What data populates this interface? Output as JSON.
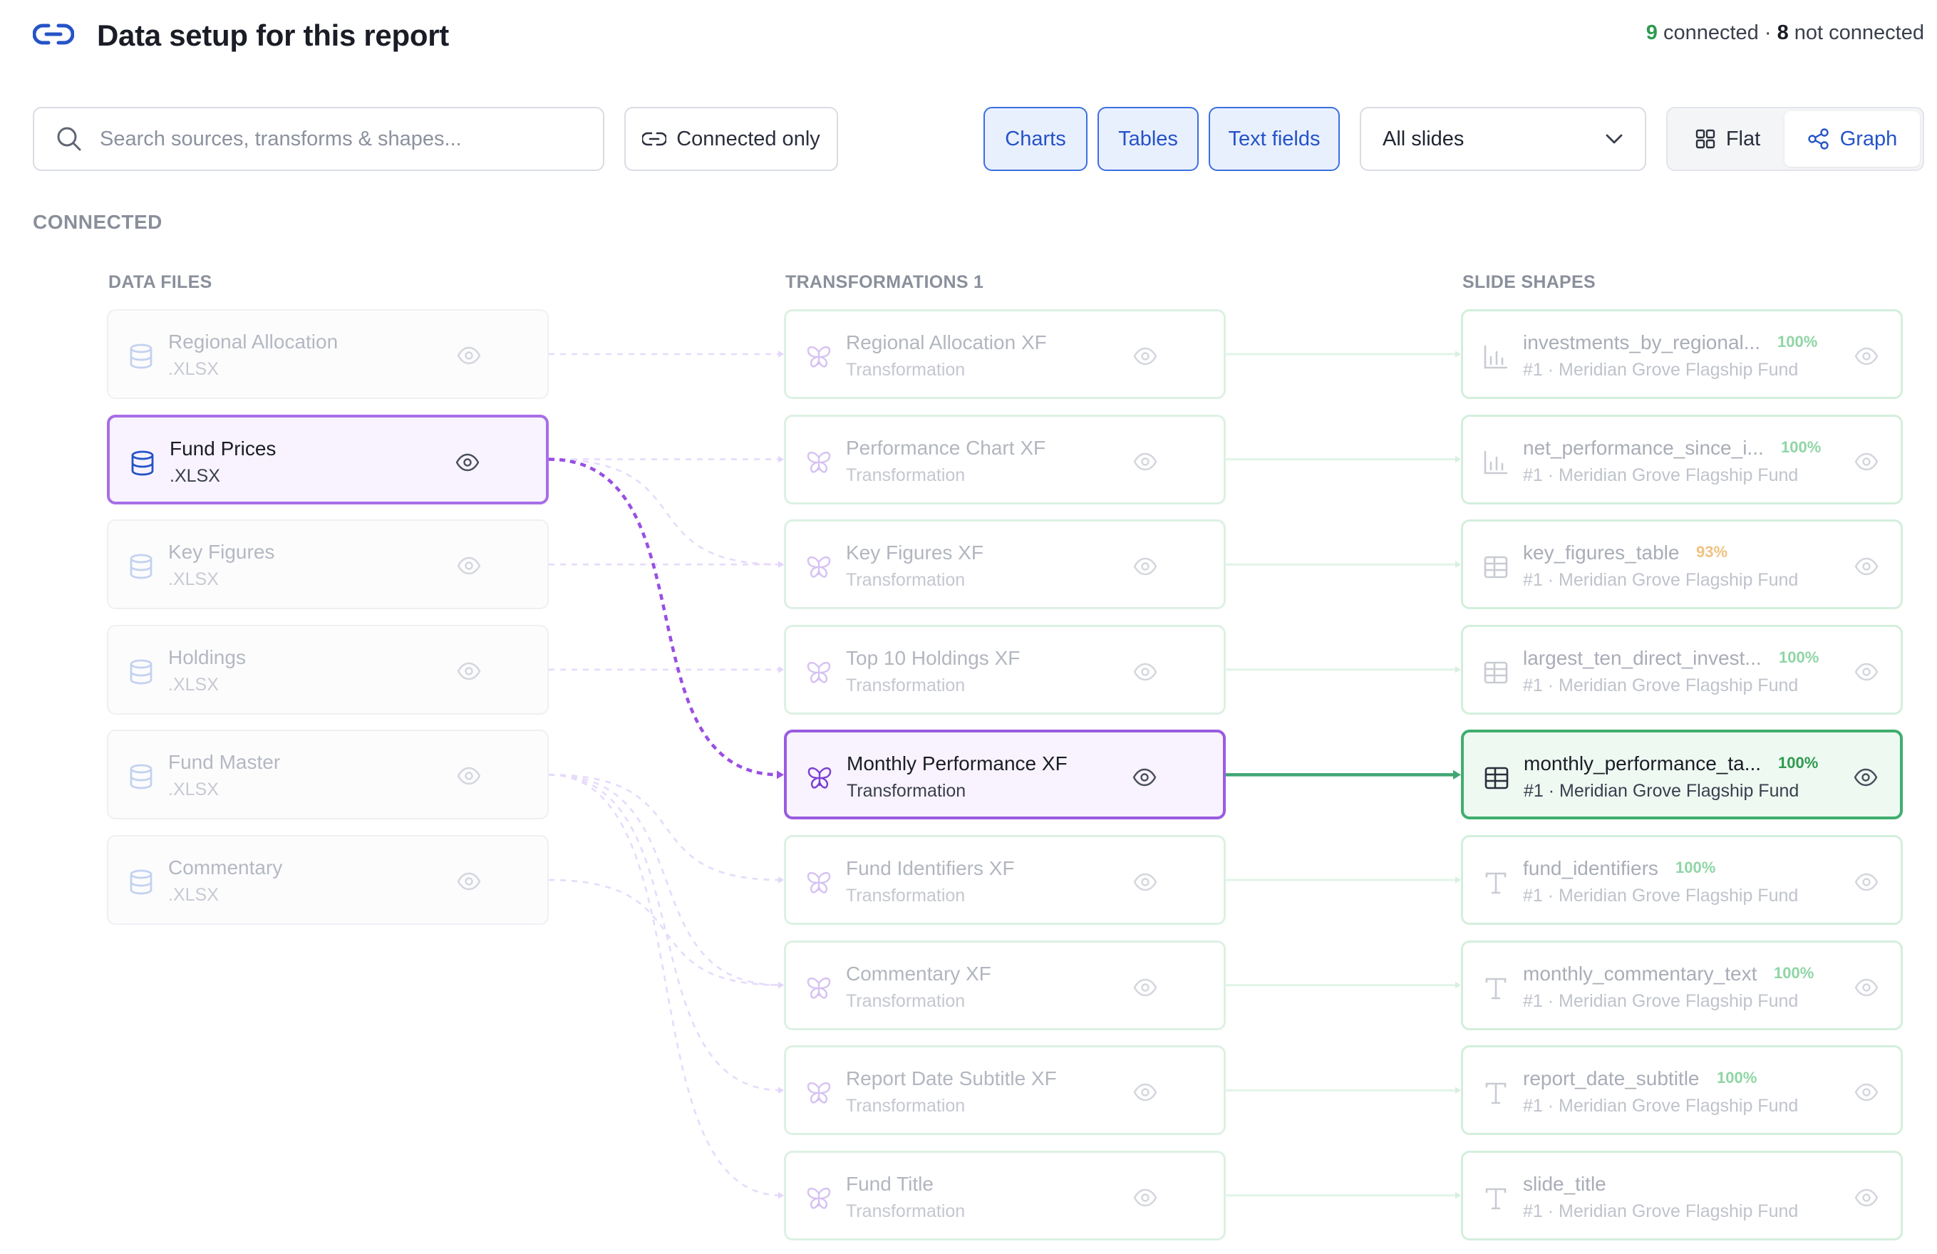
{
  "header": {
    "title": "Data setup for this report",
    "connected_count": "9",
    "connected_label": "connected",
    "separator": "·",
    "not_connected_count": "8",
    "not_connected_label": "not connected"
  },
  "toolbar": {
    "search_placeholder": "Search sources, transforms & shapes...",
    "connected_only_label": "Connected only",
    "chips": [
      "Charts",
      "Tables",
      "Text fields"
    ],
    "slides_select_value": "All slides",
    "view_flat_label": "Flat",
    "view_graph_label": "Graph",
    "active_view": "Graph"
  },
  "section_label": "CONNECTED",
  "columns": {
    "files_label": "DATA FILES",
    "transforms_label": "TRANSFORMATIONS 1",
    "shapes_label": "SLIDE SHAPES"
  },
  "colors": {
    "accent_blue": "#2553c7",
    "purple_active": "#9a5ce0",
    "green_active": "#3fae6e"
  },
  "files": [
    {
      "name": "Regional Allocation",
      "ext": ".XLSX",
      "icon": "database-icon",
      "active": false
    },
    {
      "name": "Fund Prices",
      "ext": ".XLSX",
      "icon": "database-icon",
      "active": true
    },
    {
      "name": "Key Figures",
      "ext": ".XLSX",
      "icon": "database-icon",
      "active": false
    },
    {
      "name": "Holdings",
      "ext": ".XLSX",
      "icon": "database-icon",
      "active": false
    },
    {
      "name": "Fund Master",
      "ext": ".XLSX",
      "icon": "database-icon",
      "active": false
    },
    {
      "name": "Commentary",
      "ext": ".XLSX",
      "icon": "database-icon",
      "active": false
    }
  ],
  "transforms": [
    {
      "name": "Regional Allocation XF",
      "type": "Transformation",
      "icon": "butterfly-icon",
      "active": false
    },
    {
      "name": "Performance Chart XF",
      "type": "Transformation",
      "icon": "butterfly-icon",
      "active": false
    },
    {
      "name": "Key Figures XF",
      "type": "Transformation",
      "icon": "butterfly-icon",
      "active": false
    },
    {
      "name": "Top 10 Holdings XF",
      "type": "Transformation",
      "icon": "butterfly-icon",
      "active": false
    },
    {
      "name": "Monthly Performance XF",
      "type": "Transformation",
      "icon": "butterfly-icon",
      "active": true
    },
    {
      "name": "Fund Identifiers XF",
      "type": "Transformation",
      "icon": "butterfly-icon",
      "active": false
    },
    {
      "name": "Commentary XF",
      "type": "Transformation",
      "icon": "butterfly-icon",
      "active": false
    },
    {
      "name": "Report Date Subtitle XF",
      "type": "Transformation",
      "icon": "butterfly-icon",
      "active": false
    },
    {
      "name": "Fund Title",
      "type": "Transformation",
      "icon": "butterfly-icon",
      "active": false
    }
  ],
  "shapes": [
    {
      "name": "investments_by_regional...",
      "pct": "100%",
      "slide": "#1 · Meridian Grove Flagship Fund",
      "icon": "bar-chart-icon",
      "active": false,
      "warn": false
    },
    {
      "name": "net_performance_since_i...",
      "pct": "100%",
      "slide": "#1 · Meridian Grove Flagship Fund",
      "icon": "bar-chart-icon",
      "active": false,
      "warn": false
    },
    {
      "name": "key_figures_table",
      "pct": "93%",
      "slide": "#1 · Meridian Grove Flagship Fund",
      "icon": "table-icon",
      "active": false,
      "warn": true
    },
    {
      "name": "largest_ten_direct_invest...",
      "pct": "100%",
      "slide": "#1 · Meridian Grove Flagship Fund",
      "icon": "table-icon",
      "active": false,
      "warn": false
    },
    {
      "name": "monthly_performance_ta...",
      "pct": "100%",
      "slide": "#1 · Meridian Grove Flagship Fund",
      "icon": "table-icon",
      "active": true,
      "warn": false
    },
    {
      "name": "fund_identifiers",
      "pct": "100%",
      "slide": "#1 · Meridian Grove Flagship Fund",
      "icon": "text-icon",
      "active": false,
      "warn": false
    },
    {
      "name": "monthly_commentary_text",
      "pct": "100%",
      "slide": "#1 · Meridian Grove Flagship Fund",
      "icon": "text-icon",
      "active": false,
      "warn": false
    },
    {
      "name": "report_date_subtitle",
      "pct": "100%",
      "slide": "#1 · Meridian Grove Flagship Fund",
      "icon": "text-icon",
      "active": false,
      "warn": false
    },
    {
      "name": "slide_title",
      "pct": "",
      "slide": "#1 · Meridian Grove Flagship Fund",
      "icon": "text-icon",
      "active": false,
      "warn": false
    }
  ],
  "file_links": [
    [
      0,
      0
    ],
    [
      1,
      1
    ],
    [
      1,
      2
    ],
    [
      1,
      4
    ],
    [
      2,
      2
    ],
    [
      3,
      3
    ],
    [
      4,
      5
    ],
    [
      4,
      6
    ],
    [
      4,
      7
    ],
    [
      4,
      8
    ],
    [
      5,
      6
    ]
  ],
  "active_file_link": [
    1,
    4
  ],
  "active_shape_link": [
    4,
    4
  ]
}
